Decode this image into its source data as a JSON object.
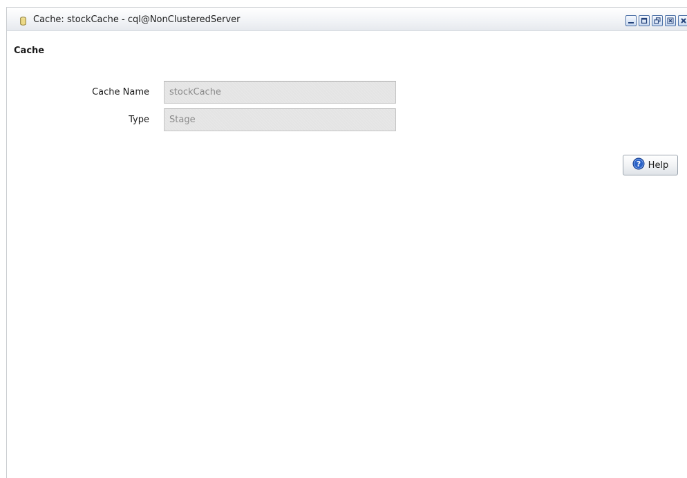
{
  "window": {
    "title": "Cache: stockCache - cql@NonClusteredServer",
    "title_icon": "database-icon",
    "controls": [
      {
        "name": "minimize-icon"
      },
      {
        "name": "maximize-icon"
      },
      {
        "name": "restore-icon"
      },
      {
        "name": "close-icon"
      },
      {
        "name": "close-all-icon"
      }
    ]
  },
  "section": {
    "title": "Cache"
  },
  "form": {
    "cache_name_label": "Cache Name",
    "cache_name_value": "stockCache",
    "type_label": "Type",
    "type_value": "Stage"
  },
  "help": {
    "label": "Help",
    "icon": "help-icon"
  },
  "colors": {
    "field_background": "#e4e4e4",
    "field_text": "#8a8a8a",
    "window_control_border": "#4a6fa5",
    "help_icon": "#2b62c7"
  }
}
